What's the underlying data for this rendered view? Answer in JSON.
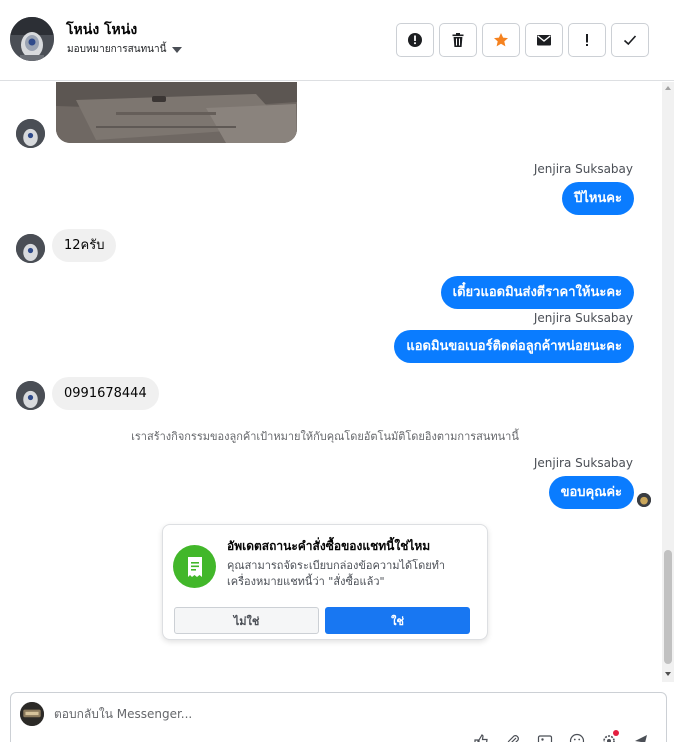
{
  "header": {
    "contact_name": "โหน่ง โหน่ง",
    "assign_label": "มอบหมายการสนทนานี้",
    "toolbar": [
      {
        "icon": "alert-circle-icon",
        "name": "report-button"
      },
      {
        "icon": "trash-icon",
        "name": "delete-button"
      },
      {
        "icon": "star-icon",
        "name": "star-button"
      },
      {
        "icon": "envelope-icon",
        "name": "mark-unread-button"
      },
      {
        "icon": "exclamation-icon",
        "name": "mark-important-button"
      },
      {
        "icon": "checkmark-icon",
        "name": "mark-done-button"
      }
    ]
  },
  "thread": {
    "messages": [
      {
        "direction": "in",
        "type": "photo"
      },
      {
        "direction": "out",
        "sender": "Jenjira Suksabay",
        "text": "ปีไหนคะ"
      },
      {
        "direction": "in",
        "text": "12ครับ"
      },
      {
        "direction": "out",
        "text": "เดี๋ยวแอดมินส่งตีราคาให้นะคะ"
      },
      {
        "direction": "out",
        "sender": "Jenjira Suksabay",
        "text": "แอดมินขอเบอร์ติดต่อลูกค้าหน่อยนะคะ"
      },
      {
        "direction": "in",
        "text": "0991678444"
      },
      {
        "direction": "system",
        "text": "เราสร้างกิจกรรมของลูกค้าเป้าหมายให้กับคุณโดยอัตโนมัติโดยอิงตามการสนทนานี้"
      },
      {
        "direction": "out",
        "sender": "Jenjira Suksabay",
        "text": "ขอบคุณค่ะ"
      }
    ]
  },
  "order_card": {
    "title": "อัพเดตสถานะคำสั่งซื้อของแชทนี้ใช่ไหม",
    "body": "คุณสามารถจัดระเบียบกล่องข้อความได้โดยทำเครื่องหมายแชทนี้ว่า \"สั่งซื้อแล้ว\"",
    "no_label": "ไม่ใช่",
    "yes_label": "ใช่",
    "icon": "receipt-icon"
  },
  "composer": {
    "placeholder": "ตอบกลับใน Messenger..."
  },
  "colors": {
    "outgoing_bubble": "#0a7cff",
    "incoming_bubble": "#f0f0f0",
    "primary_button": "#1877f2",
    "card_icon_bg": "#42b72a",
    "star": "#f5821f"
  }
}
